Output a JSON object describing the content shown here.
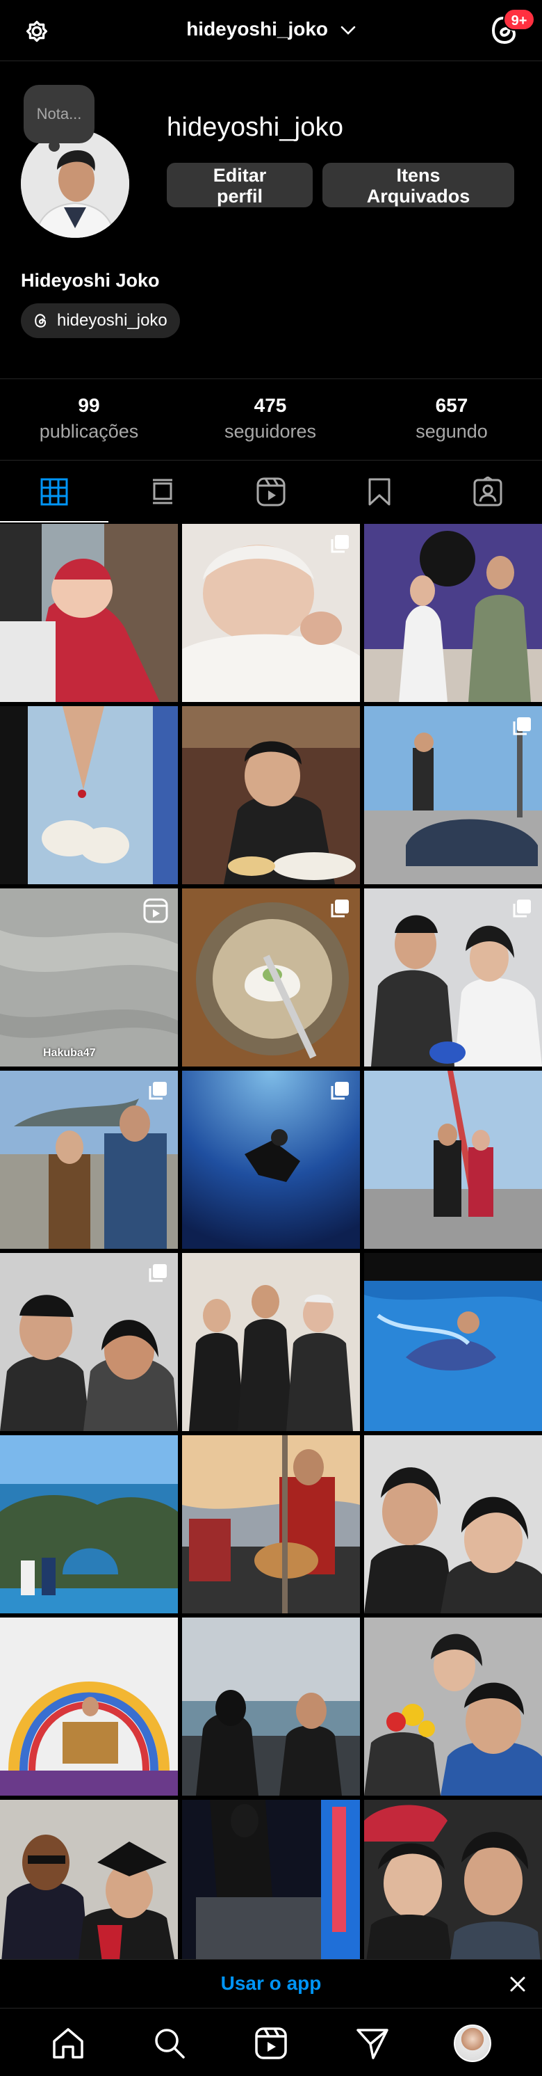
{
  "header": {
    "username": "hideyoshi_joko",
    "notification_badge": "9+"
  },
  "profile": {
    "note_placeholder": "Nota...",
    "username": "hideyoshi_joko",
    "edit_profile_label": "Editar perfil",
    "archived_label": "Itens Arquivados",
    "display_name": "Hideyoshi Joko",
    "threads_handle": "hideyoshi_joko"
  },
  "stats": {
    "posts": {
      "value": "99",
      "label": "publicações"
    },
    "followers": {
      "value": "475",
      "label": "seguidores"
    },
    "following": {
      "value": "657",
      "label": "segundo"
    }
  },
  "tabs": [
    "grid-icon",
    "feed-icon",
    "reels-icon",
    "saved-icon",
    "tagged-icon"
  ],
  "grid": {
    "posts": [
      {
        "desc": "baby-red-dress",
        "multi": false,
        "reel": false
      },
      {
        "desc": "newborn-sleeping",
        "multi": true,
        "reel": false
      },
      {
        "desc": "gender-reveal-couple",
        "multi": false,
        "reel": false
      },
      {
        "desc": "baby-shoes-hands",
        "multi": false,
        "reel": false
      },
      {
        "desc": "man-eating-restaurant",
        "multi": false,
        "reel": false
      },
      {
        "desc": "man-with-car",
        "multi": true,
        "reel": false
      },
      {
        "desc": "beach-sand",
        "multi": false,
        "reel": true
      },
      {
        "desc": "food-bowl",
        "multi": true,
        "reel": false
      },
      {
        "desc": "couple-wedding",
        "multi": true,
        "reel": false
      },
      {
        "desc": "couple-masks-aquarium",
        "multi": true,
        "reel": false
      },
      {
        "desc": "scuba-diver",
        "multi": true,
        "reel": false
      },
      {
        "desc": "couple-tower",
        "multi": false,
        "reel": false
      },
      {
        "desc": "couple-selfie-jackets",
        "multi": true,
        "reel": false
      },
      {
        "desc": "group-formal",
        "multi": false,
        "reel": false
      },
      {
        "desc": "man-swimming-pool",
        "multi": false,
        "reel": false
      },
      {
        "desc": "sea-rock-arch",
        "multi": false,
        "reel": false
      },
      {
        "desc": "guitar-sunset",
        "multi": false,
        "reel": false
      },
      {
        "desc": "couple-selfie-smiling",
        "multi": false,
        "reel": false
      },
      {
        "desc": "church-balloons",
        "multi": false,
        "reel": false
      },
      {
        "desc": "lake-view-couple",
        "multi": false,
        "reel": false
      },
      {
        "desc": "flowers-couple",
        "multi": false,
        "reel": false
      },
      {
        "desc": "graduation",
        "multi": false,
        "reel": false
      },
      {
        "desc": "arcade-night",
        "multi": false,
        "reel": false
      },
      {
        "desc": "couple-hats-selfie",
        "multi": false,
        "reel": false
      }
    ],
    "caption_beach": "Hakuba47"
  },
  "banner": {
    "use_app_label": "Usar o app"
  },
  "bottom_nav": [
    "home-icon",
    "search-icon",
    "reels-icon",
    "direct-icon",
    "profile-avatar"
  ]
}
